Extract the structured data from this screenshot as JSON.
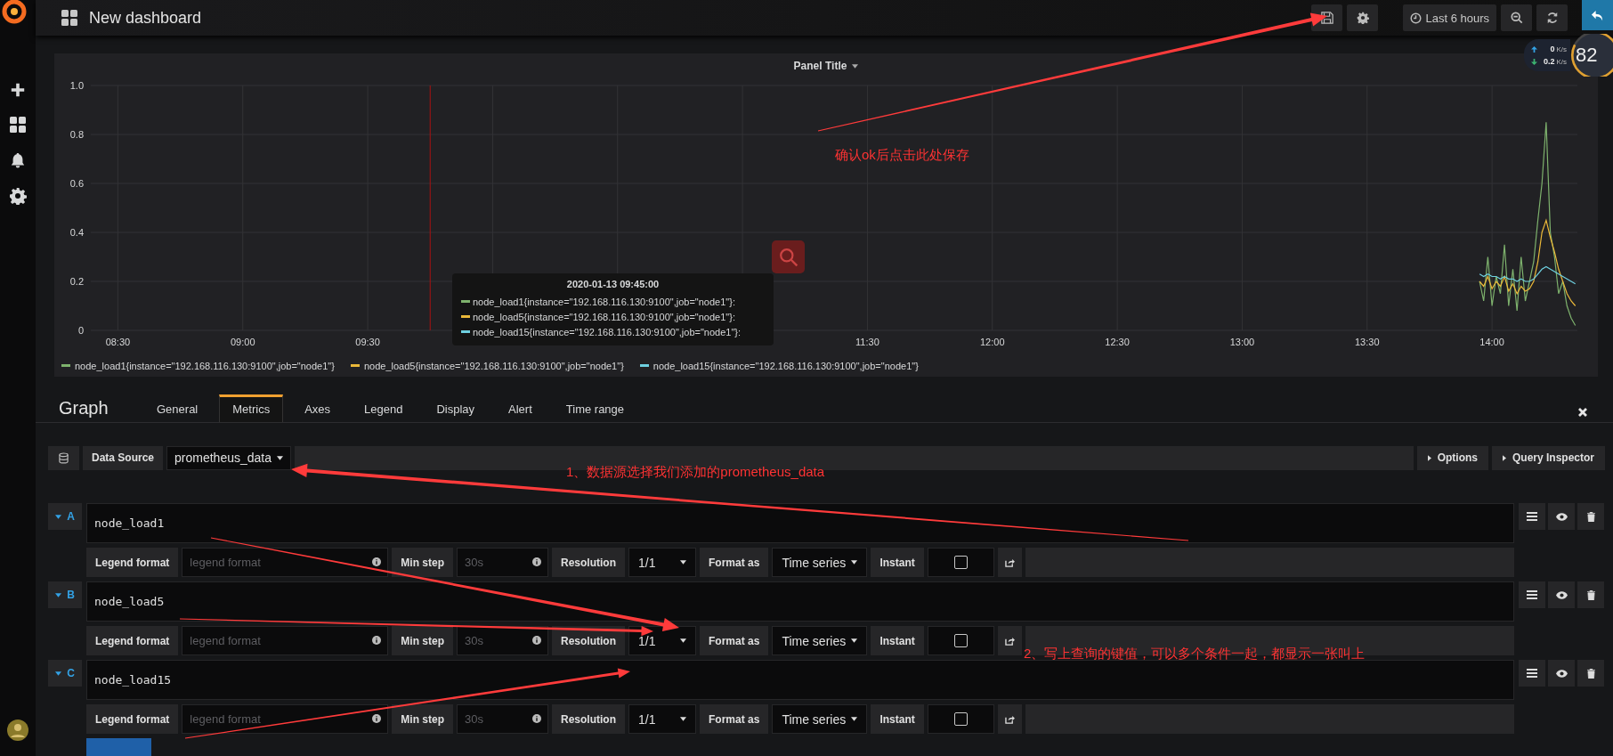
{
  "topbar": {
    "title": "New dashboard",
    "time_range": "Last 6 hours"
  },
  "network_widget": {
    "upload": "0",
    "upload_unit": "K/s",
    "download": "0.2",
    "download_unit": "K/s",
    "cpu": "82"
  },
  "panel": {
    "title": "Panel Title",
    "chart_data": {
      "type": "line",
      "x": [
        837,
        838,
        839,
        840,
        841,
        842,
        843,
        844,
        845,
        846,
        847,
        848,
        849,
        850,
        851,
        852,
        853,
        854,
        855,
        856,
        857,
        858,
        859,
        860
      ],
      "series": [
        {
          "name": "node_load1{instance=\"192.168.116.130:9100\",job=\"node1\"}",
          "color": "#7eb26d",
          "values": [
            0.2,
            0.12,
            0.3,
            0.1,
            0.22,
            0.15,
            0.35,
            0.1,
            0.25,
            0.08,
            0.3,
            0.12,
            0.2,
            0.28,
            0.45,
            0.6,
            0.85,
            0.4,
            0.3,
            0.15,
            0.2,
            0.1,
            0.05,
            0.02
          ]
        },
        {
          "name": "node_load5{instance=\"192.168.116.130:9100\",job=\"node1\"}",
          "color": "#eab839",
          "values": [
            0.2,
            0.18,
            0.22,
            0.17,
            0.2,
            0.18,
            0.22,
            0.16,
            0.19,
            0.15,
            0.18,
            0.16,
            0.17,
            0.2,
            0.28,
            0.4,
            0.45,
            0.38,
            0.32,
            0.25,
            0.2,
            0.15,
            0.12,
            0.1
          ]
        },
        {
          "name": "node_load15{instance=\"192.168.116.130:9100\",job=\"node1\"}",
          "color": "#6ed0e0",
          "values": [
            0.23,
            0.22,
            0.23,
            0.22,
            0.22,
            0.21,
            0.22,
            0.21,
            0.21,
            0.2,
            0.21,
            0.2,
            0.2,
            0.21,
            0.23,
            0.25,
            0.26,
            0.25,
            0.24,
            0.23,
            0.22,
            0.21,
            0.2,
            0.19
          ]
        }
      ],
      "xlim": [
        503.5,
        860.5
      ],
      "ylim": [
        0,
        1
      ],
      "xticks": [
        {
          "value": 510,
          "label": "08:30"
        },
        {
          "value": 540,
          "label": "09:00"
        },
        {
          "value": 570,
          "label": "09:30"
        },
        {
          "value": 690,
          "label": "11:30"
        },
        {
          "value": 720,
          "label": "12:00"
        },
        {
          "value": 750,
          "label": "12:30"
        },
        {
          "value": 780,
          "label": "13:00"
        },
        {
          "value": 810,
          "label": "13:30"
        },
        {
          "value": 840,
          "label": "14:00"
        }
      ],
      "yticks": [
        {
          "value": 0,
          "label": "0"
        },
        {
          "value": 0.2,
          "label": "0.2"
        },
        {
          "value": 0.4,
          "label": "0.4"
        },
        {
          "value": 0.6,
          "label": "0.6"
        },
        {
          "value": 0.8,
          "label": "0.8"
        },
        {
          "value": 1,
          "label": "1.0"
        }
      ],
      "grid": true,
      "ref_lines": [
        {
          "axis": "x",
          "value": 585,
          "color": "#aa1111"
        }
      ]
    },
    "tooltip": {
      "time": "2020-01-13 09:45:00",
      "items": [
        {
          "label": "node_load1{instance=\"192.168.116.130:9100\",job=\"node1\"}:",
          "color": "#7eb26d"
        },
        {
          "label": "node_load5{instance=\"192.168.116.130:9100\",job=\"node1\"}:",
          "color": "#eab839"
        },
        {
          "label": "node_load15{instance=\"192.168.116.130:9100\",job=\"node1\"}:",
          "color": "#6ed0e0"
        }
      ]
    }
  },
  "editor": {
    "title": "Graph",
    "tabs": [
      {
        "label": "General",
        "selected": false
      },
      {
        "label": "Metrics",
        "selected": true
      },
      {
        "label": "Axes",
        "selected": false
      },
      {
        "label": "Legend",
        "selected": false
      },
      {
        "label": "Display",
        "selected": false
      },
      {
        "label": "Alert",
        "selected": false
      },
      {
        "label": "Time range",
        "selected": false
      }
    ],
    "data_source": {
      "label": "Data Source",
      "value": "prometheus_data"
    },
    "buttons": [
      "Options",
      "Query Inspector"
    ],
    "queries": [
      {
        "letter": "A",
        "expr": "node_load1",
        "legend_label": "Legend format",
        "legend_placeholder": "legend format",
        "min_step_label": "Min step",
        "min_step_placeholder": "30s",
        "resolution_label": "Resolution",
        "resolution": "1/1",
        "format_label": "Format as",
        "format": "Time series",
        "instant_label": "Instant",
        "instant": false
      },
      {
        "letter": "B",
        "expr": "node_load5",
        "legend_label": "Legend format",
        "legend_placeholder": "legend format",
        "min_step_label": "Min step",
        "min_step_placeholder": "30s",
        "resolution_label": "Resolution",
        "resolution": "1/1",
        "format_label": "Format as",
        "format": "Time series",
        "instant_label": "Instant",
        "instant": false
      },
      {
        "letter": "C",
        "expr": "node_load15",
        "legend_label": "Legend format",
        "legend_placeholder": "legend format",
        "min_step_label": "Min step",
        "min_step_placeholder": "30s",
        "resolution_label": "Resolution",
        "resolution": "1/1",
        "format_label": "Format as",
        "format": "Time series",
        "instant_label": "Instant",
        "instant": false
      }
    ]
  },
  "annotations": [
    {
      "text": "确认ok后点击此处保存"
    },
    {
      "text": "1、数据源选择我们添加的prometheus_data"
    },
    {
      "text": "2、写上查询的键值，可以多个条件一起，都显示一张叫上"
    }
  ]
}
